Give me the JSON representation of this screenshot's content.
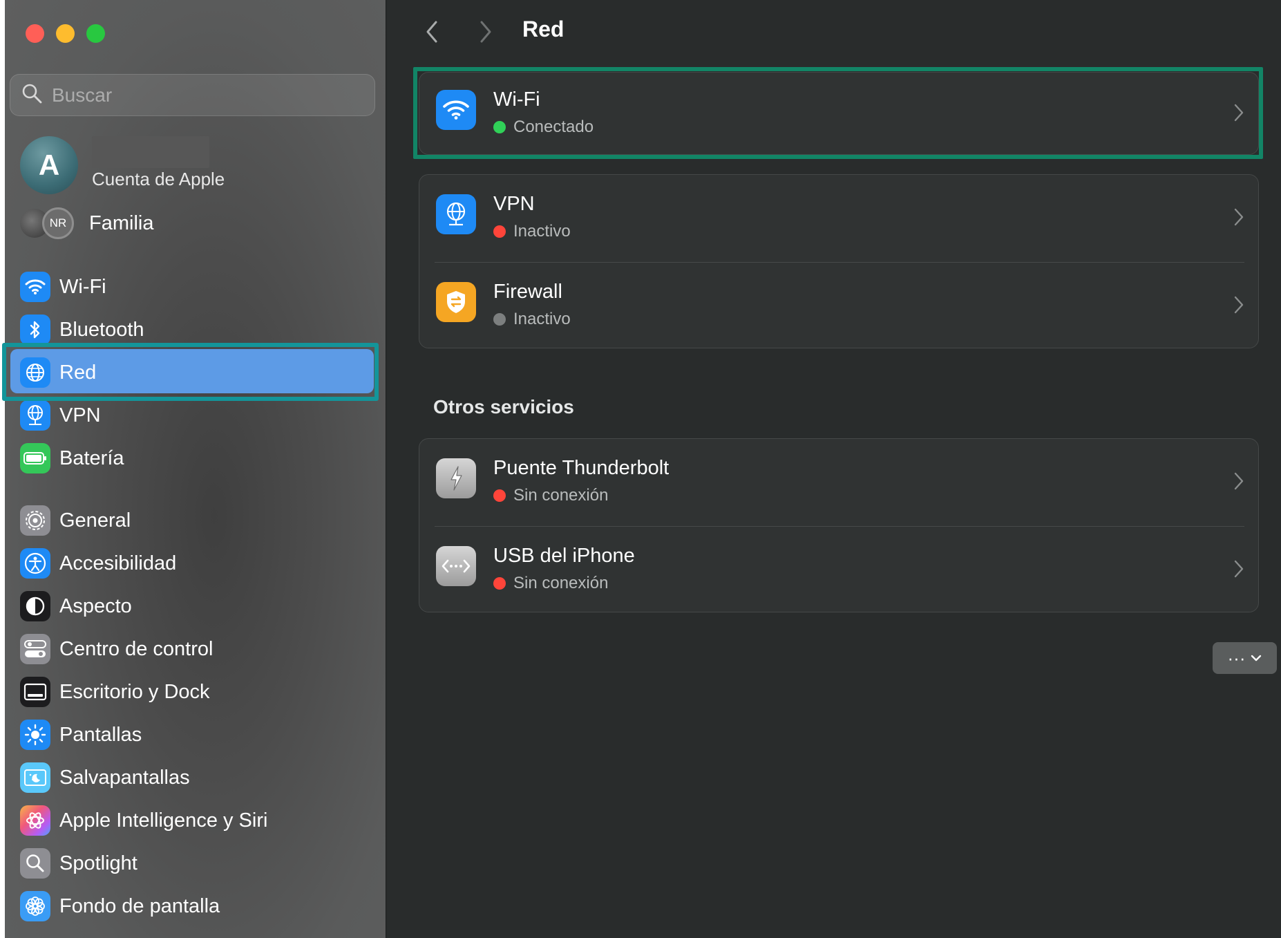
{
  "search": {
    "placeholder": "Buscar"
  },
  "account": {
    "avatar_letter": "A",
    "subtitle": "Cuenta de Apple"
  },
  "family": {
    "avatar_initials": "NR",
    "label": "Familia"
  },
  "sidebar": {
    "items": [
      {
        "label": "Wi-Fi",
        "icon": "wifi-icon",
        "color": "#1e8af5"
      },
      {
        "label": "Bluetooth",
        "icon": "bluetooth-icon",
        "color": "#1e8af5"
      },
      {
        "label": "Red",
        "icon": "globe-icon",
        "color": "#1e8af5",
        "selected": true
      },
      {
        "label": "VPN",
        "icon": "vpn-globe-icon",
        "color": "#1e8af5"
      },
      {
        "label": "Batería",
        "icon": "battery-icon",
        "color": "#34c759"
      },
      {
        "label": "General",
        "icon": "gear-icon",
        "color": "#8e8e93"
      },
      {
        "label": "Accesibilidad",
        "icon": "accessibility-icon",
        "color": "#1e8af5"
      },
      {
        "label": "Aspecto",
        "icon": "appearance-icon",
        "color": "#1c1c1e"
      },
      {
        "label": "Centro de control",
        "icon": "control-center-icon",
        "color": "#8e8e93"
      },
      {
        "label": "Escritorio y Dock",
        "icon": "desktop-dock-icon",
        "color": "#1c1c1e"
      },
      {
        "label": "Pantallas",
        "icon": "displays-icon",
        "color": "#1e8af5"
      },
      {
        "label": "Salvapantallas",
        "icon": "screensaver-icon",
        "color": "#5ac8fa"
      },
      {
        "label": "Apple Intelligence y Siri",
        "icon": "siri-icon",
        "color": "#e15bd1"
      },
      {
        "label": "Spotlight",
        "icon": "spotlight-icon",
        "color": "#8e8e93"
      },
      {
        "label": "Fondo de pantalla",
        "icon": "wallpaper-icon",
        "color": "#3a9cf5"
      }
    ]
  },
  "main": {
    "title": "Red",
    "services": [
      {
        "title": "Wi-Fi",
        "status": "Conectado",
        "status_color": "#30d158",
        "icon": "wifi-icon"
      },
      {
        "title": "VPN",
        "status": "Inactivo",
        "status_color": "#ff453a",
        "icon": "vpn-globe-icon"
      },
      {
        "title": "Firewall",
        "status": "Inactivo",
        "status_color": "#7c7f7f",
        "icon": "firewall-icon"
      }
    ],
    "other_section_title": "Otros servicios",
    "other_services": [
      {
        "title": "Puente Thunderbolt",
        "status": "Sin conexión",
        "status_color": "#ff453a",
        "icon": "thunderbolt-icon"
      },
      {
        "title": "USB del iPhone",
        "status": "Sin conexión",
        "status_color": "#ff453a",
        "icon": "usb-iphone-icon"
      }
    ],
    "more_button_label": "···",
    "help_button_label": "?"
  }
}
